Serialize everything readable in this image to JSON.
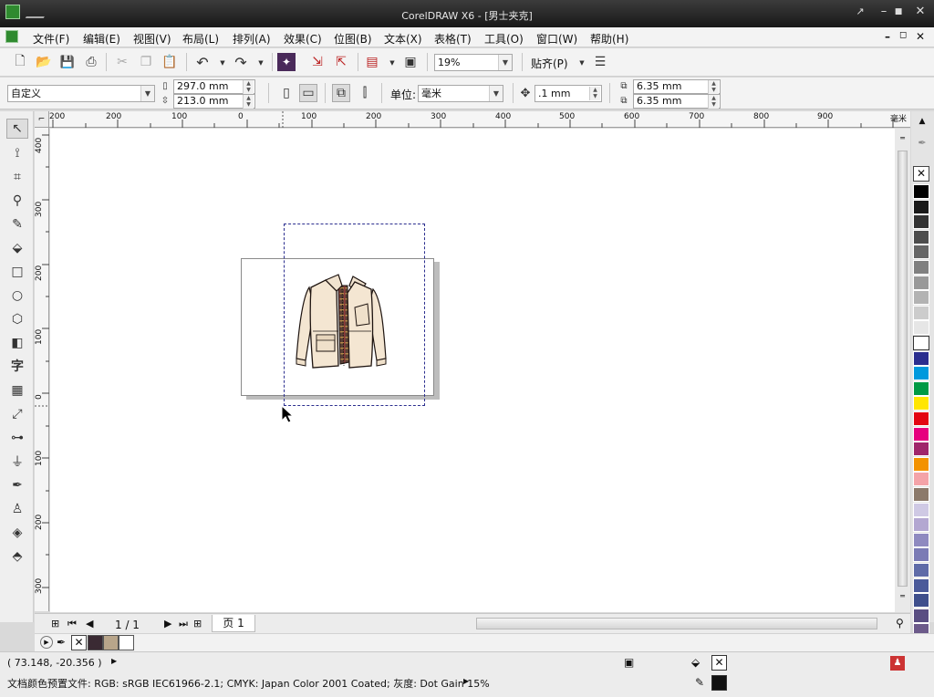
{
  "window": {
    "title": "CorelDRAW X6 - [男士夹克]"
  },
  "menu": {
    "items": [
      "文件(F)",
      "编辑(E)",
      "视图(V)",
      "布局(L)",
      "排列(A)",
      "效果(C)",
      "位图(B)",
      "文本(X)",
      "表格(T)",
      "工具(O)",
      "窗口(W)",
      "帮助(H)"
    ]
  },
  "standard_toolbar": {
    "zoom": "19%",
    "snap": "贴齐(P)"
  },
  "property_bar": {
    "page_preset": "自定义",
    "width": "297.0 mm",
    "height": "213.0 mm",
    "units_label": "单位:",
    "units_value": "毫米",
    "nudge": ".1 mm",
    "dup_x": "6.35 mm",
    "dup_y": "6.35 mm"
  },
  "ruler": {
    "top_ticks": [
      "200",
      "100",
      "0",
      "100",
      "200",
      "300",
      "400",
      "500",
      "600",
      "700",
      "800",
      "900"
    ],
    "top_unit": "毫米",
    "left_ticks": [
      "400",
      "300",
      "200",
      "100",
      "0",
      "100",
      "200",
      "300"
    ]
  },
  "page_nav": {
    "count": "1 / 1",
    "tab": "页 1"
  },
  "status": {
    "coords": "( 73.148, -20.356 )",
    "color_profile": "文档颜色预置文件: RGB: sRGB IEC61966-2.1; CMYK: Japan Color 2001 Coated; 灰度: Dot Gain 15%"
  },
  "colors": {
    "palette": [
      "#000000",
      "#1a1a1a",
      "#333333",
      "#4d4d4d",
      "#666666",
      "#808080",
      "#999999",
      "#b3b3b3",
      "#cccccc",
      "#e6e6e6",
      "#ffffff",
      "#2b2e8f",
      "#0099dd",
      "#009a44",
      "#ffe600",
      "#e30613",
      "#e6007e",
      "#a0266b",
      "#f39200",
      "#f4a3a8",
      "#8c7a6b",
      "#cfc9e4",
      "#b3a7d1",
      "#8f8ac0",
      "#7b7bb5",
      "#5f6ba8",
      "#4b5a9a",
      "#3f4f8c",
      "#5a4e82",
      "#6c5a8a"
    ],
    "doc_palette": [
      "#3a2a33",
      "#b8a58a",
      "#ffffff"
    ],
    "fill": "#111111"
  }
}
